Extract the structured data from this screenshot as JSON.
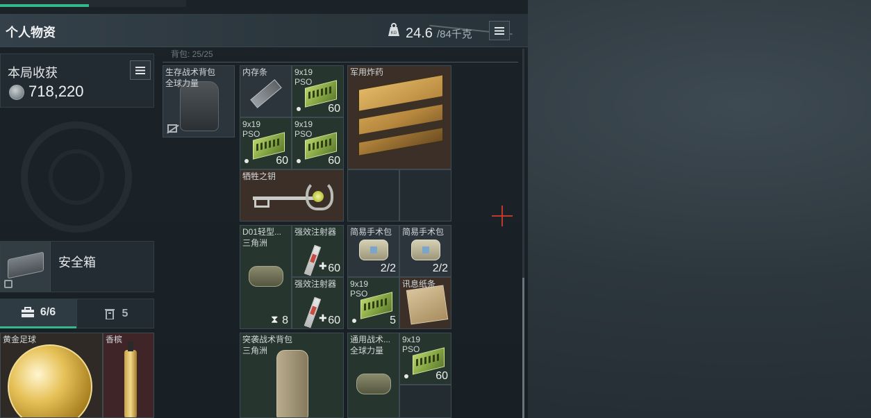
{
  "header": {
    "title": "个人物资",
    "weight_current": "24.6",
    "weight_max": "/84千克"
  },
  "harvest": {
    "title": "本局收获",
    "value": "718,220"
  },
  "safebox": {
    "label": "安全箱"
  },
  "container_tabs": [
    {
      "icon": "toolbox-icon",
      "count": "6/6"
    },
    {
      "icon": "bin-icon",
      "count": "5"
    }
  ],
  "grid_header": "背包: 25/25",
  "backpack_slot": {
    "name": "生存战术背包",
    "sub": "全球力量"
  },
  "items": {
    "ram": {
      "name": "内存条"
    },
    "ammo1": {
      "name": "9x19",
      "sub": "PSO",
      "count": "60"
    },
    "ammo2": {
      "name": "9x19",
      "sub": "PSO",
      "count": "60"
    },
    "ammo3": {
      "name": "9x19",
      "sub": "PSO",
      "count": "60"
    },
    "explosive": {
      "name": "军用炸药"
    },
    "key": {
      "name": "牺牲之钥"
    },
    "d01": {
      "name": "D01轻型...",
      "sub": "三角洲",
      "count": "8"
    },
    "syringe1": {
      "name": "强效注射器",
      "count": "60"
    },
    "syringe2": {
      "name": "强效注射器",
      "count": "60"
    },
    "pouch1": {
      "name": "简易手术包",
      "count": "2/2"
    },
    "pouch2": {
      "name": "简易手术包",
      "count": "2/2"
    },
    "ammo4": {
      "name": "9x19",
      "sub": "PSO",
      "count": "5"
    },
    "paper": {
      "name": "讯息纸条"
    },
    "assault_bag": {
      "name": "突袭战术背包",
      "sub": "三角洲"
    },
    "general_bag": {
      "name": "通用战术...",
      "sub": "全球力量"
    },
    "ammo5": {
      "name": "9x19",
      "sub": "PSO",
      "count": "60"
    },
    "football": {
      "name": "黄金足球"
    },
    "champagne": {
      "name": "香槟"
    }
  },
  "colors": {
    "accent": "#34b88a",
    "crosshair": "#c0392b"
  }
}
